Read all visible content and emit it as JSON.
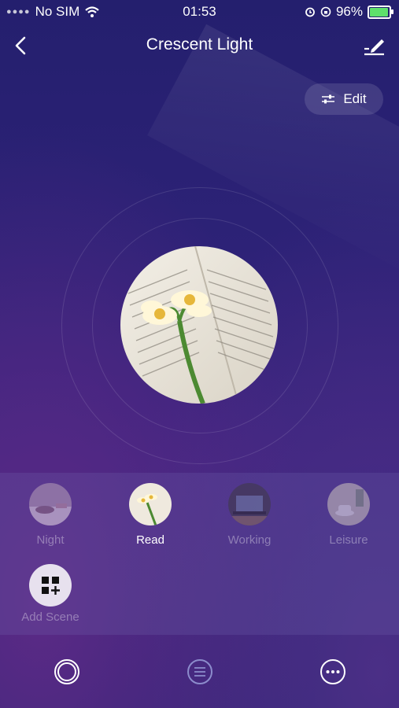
{
  "status": {
    "carrier": "No SIM",
    "time": "01:53",
    "battery": "96%"
  },
  "header": {
    "title": "Crescent Light"
  },
  "edit_button": {
    "label": "Edit"
  },
  "scenes": [
    {
      "label": "Night",
      "active": false
    },
    {
      "label": "Read",
      "active": true
    },
    {
      "label": "Working",
      "active": false
    },
    {
      "label": "Leisure",
      "active": false
    }
  ],
  "add_scene": {
    "label": "Add Scene"
  },
  "icons": {
    "back": "chevron-left-icon",
    "edit_name": "pencil-icon",
    "edit": "sliders-icon",
    "tabs": [
      "circle-icon",
      "menu-icon",
      "more-icon"
    ]
  },
  "colors": {
    "battery_fill": "#5ee06b",
    "background": "#2d2277"
  }
}
